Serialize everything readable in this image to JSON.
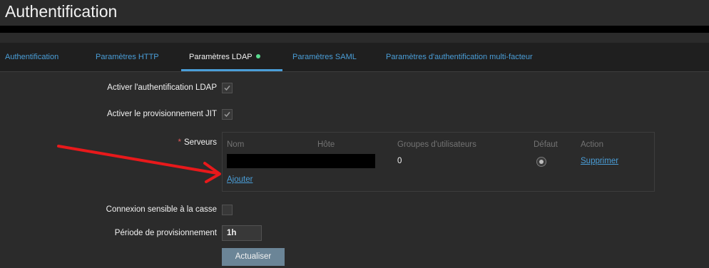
{
  "page": {
    "title": "Authentification"
  },
  "tabs": [
    {
      "label": "Authentification"
    },
    {
      "label": "Paramètres HTTP"
    },
    {
      "label": "Paramètres LDAP"
    },
    {
      "label": "Paramètres SAML"
    },
    {
      "label": "Paramètres d'authentification multi-facteur"
    }
  ],
  "form": {
    "ldap_enable_label": "Activer l'authentification LDAP",
    "ldap_enable_checked": true,
    "jit_label": "Activer le provisionnement JIT",
    "jit_checked": true,
    "servers_required_mark": "*",
    "servers_label": "Serveurs",
    "servers_table": {
      "headers": [
        "Nom",
        "Hôte",
        "Groupes d'utilisateurs",
        "Défaut",
        "Action"
      ],
      "rows": [
        {
          "user_groups": "0",
          "default_selected": true,
          "action": "Supprimer"
        }
      ],
      "add_link": "Ajouter"
    },
    "case_sensitive_label": "Connexion sensible à la casse",
    "case_sensitive_checked": false,
    "provisioning_period_label": "Période de provisionnement",
    "provisioning_period_value": "1h",
    "update_button": "Actualiser"
  },
  "colors": {
    "accent": "#4a9ed8",
    "annotation_arrow": "#e8191b",
    "status_dot": "#59db8f"
  }
}
